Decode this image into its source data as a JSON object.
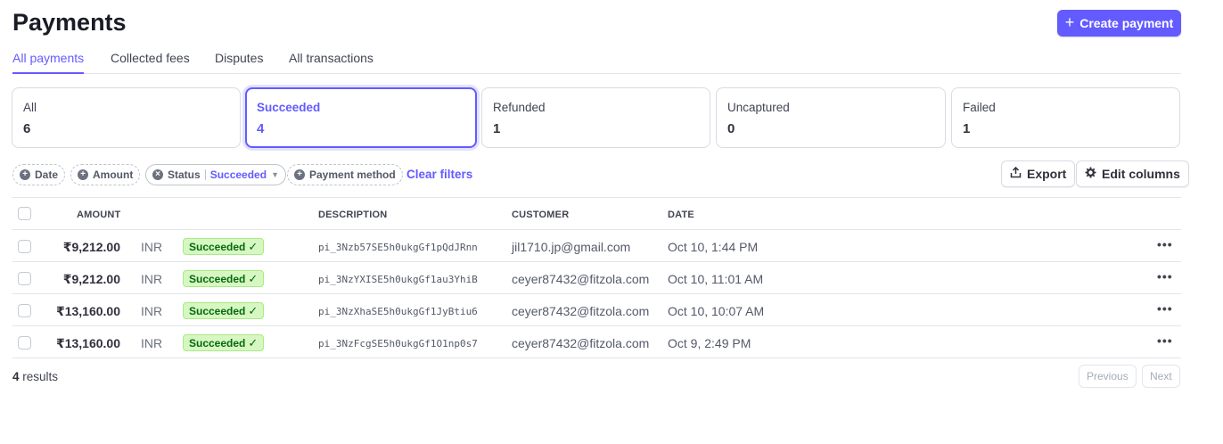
{
  "page": {
    "title": "Payments"
  },
  "actions": {
    "create_payment": "Create payment",
    "export": "Export",
    "edit_columns": "Edit columns"
  },
  "tabs": [
    "All payments",
    "Collected fees",
    "Disputes",
    "All transactions"
  ],
  "active_tab": "All payments",
  "status_cards": [
    {
      "label": "All",
      "count": "6"
    },
    {
      "label": "Succeeded",
      "count": "4"
    },
    {
      "label": "Refunded",
      "count": "1"
    },
    {
      "label": "Uncaptured",
      "count": "0"
    },
    {
      "label": "Failed",
      "count": "1"
    }
  ],
  "active_card": "Succeeded",
  "filters": {
    "date": "Date",
    "amount": "Amount",
    "status_label": "Status",
    "status_value": "Succeeded",
    "payment_method": "Payment method",
    "clear": "Clear filters"
  },
  "table": {
    "headers": {
      "amount": "AMOUNT",
      "description": "DESCRIPTION",
      "customer": "CUSTOMER",
      "date": "DATE"
    },
    "rows": [
      {
        "amount": "₹9,212.00",
        "currency": "INR",
        "status": "Succeeded",
        "description": "pi_3Nzb57SE5h0ukgGf1pQdJRnn",
        "customer": "jil1710.jp@gmail.com",
        "date": "Oct 10, 1:44 PM"
      },
      {
        "amount": "₹9,212.00",
        "currency": "INR",
        "status": "Succeeded",
        "description": "pi_3NzYXISE5h0ukgGf1au3YhiB",
        "customer": "ceyer87432@fitzola.com",
        "date": "Oct 10, 11:01 AM"
      },
      {
        "amount": "₹13,160.00",
        "currency": "INR",
        "status": "Succeeded",
        "description": "pi_3NzXhaSE5h0ukgGf1JyBtiu6",
        "customer": "ceyer87432@fitzola.com",
        "date": "Oct 10, 10:07 AM"
      },
      {
        "amount": "₹13,160.00",
        "currency": "INR",
        "status": "Succeeded",
        "description": "pi_3NzFcgSE5h0ukgGf1O1np0s7",
        "customer": "ceyer87432@fitzola.com",
        "date": "Oct 9, 2:49 PM"
      }
    ]
  },
  "footer": {
    "results_count": "4",
    "results_label": "results",
    "previous": "Previous",
    "next": "Next"
  },
  "colors": {
    "accent": "#635bff",
    "success_bg": "#d7f7c2",
    "success_text": "#05690d"
  }
}
